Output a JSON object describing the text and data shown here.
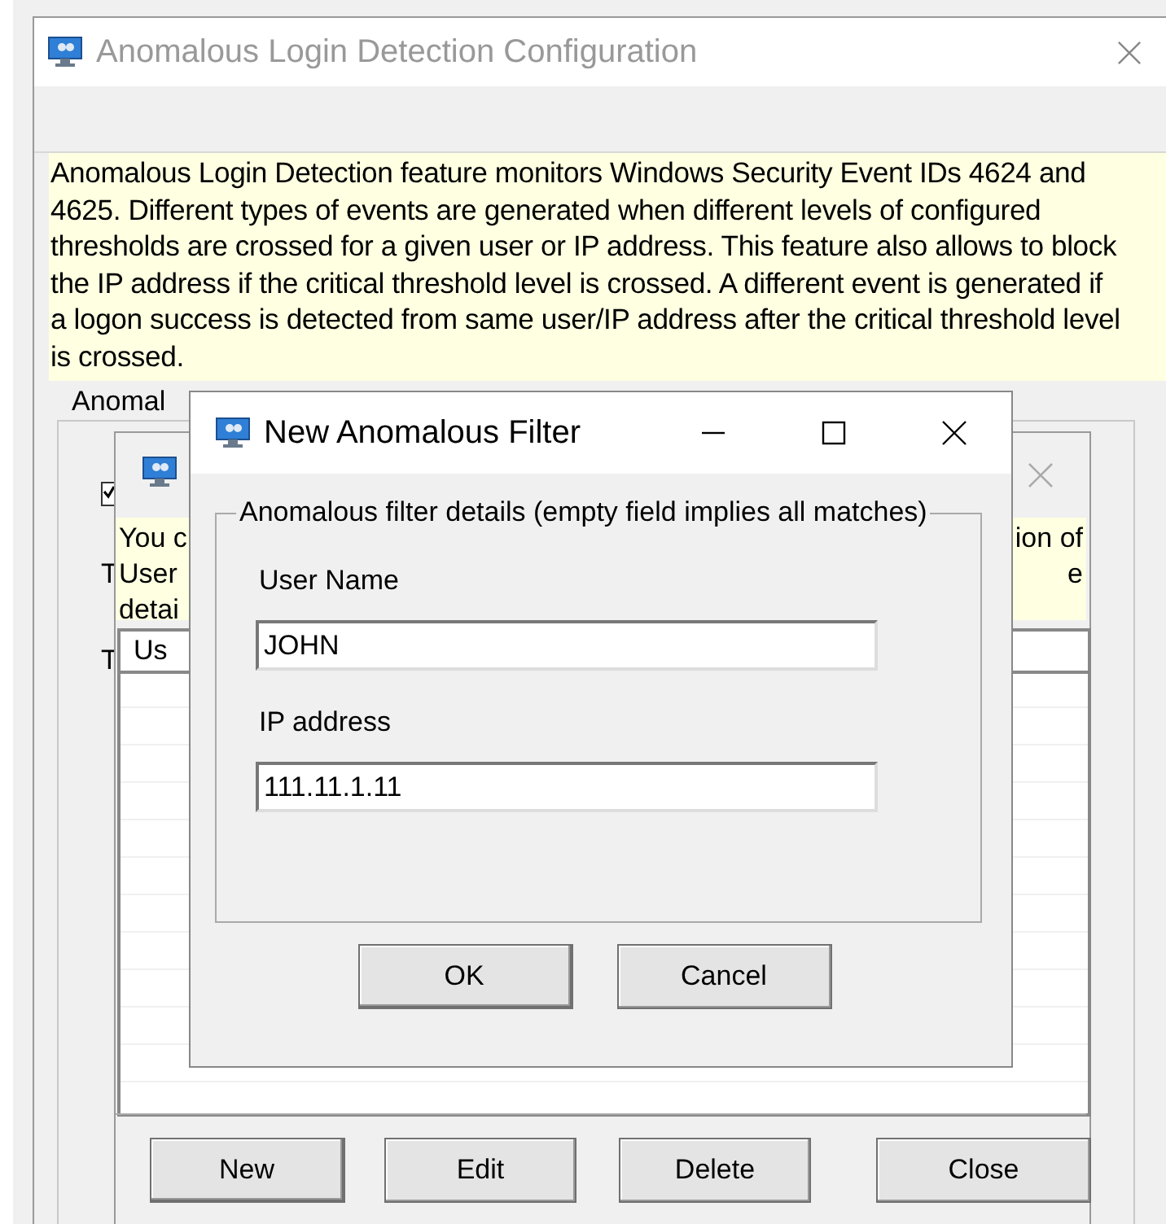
{
  "main_window": {
    "title": "Anomalous Login Detection Configuration",
    "description": "Anomalous Login Detection feature monitors Windows Security Event IDs 4624 and 4625. Different types of events are generated when different levels of configured thresholds are crossed for a given user or IP address. This feature also allows to block the IP address if the critical threshold level is crossed. A different event is generated if a logon success is detected from same user/IP address after the critical threshold level is crossed.",
    "group_label": "Anomal",
    "checkbox": {
      "checked": true
    },
    "side_labels": [
      "T",
      "T"
    ]
  },
  "list_window": {
    "note_left": [
      "You c",
      "User",
      "detai"
    ],
    "note_right": [
      "ion of",
      "e"
    ],
    "table": {
      "columns": [
        "Us"
      ]
    },
    "buttons": [
      "New",
      "Edit",
      "Delete",
      "Close"
    ]
  },
  "filter_dialog": {
    "title": "New Anomalous Filter",
    "group_label": "Anomalous filter details (empty field implies all matches)",
    "fields": [
      {
        "label": "User Name",
        "value": "JOHN"
      },
      {
        "label": "IP address",
        "value": "111.11.1.11"
      }
    ],
    "buttons": [
      "OK",
      "Cancel"
    ]
  }
}
